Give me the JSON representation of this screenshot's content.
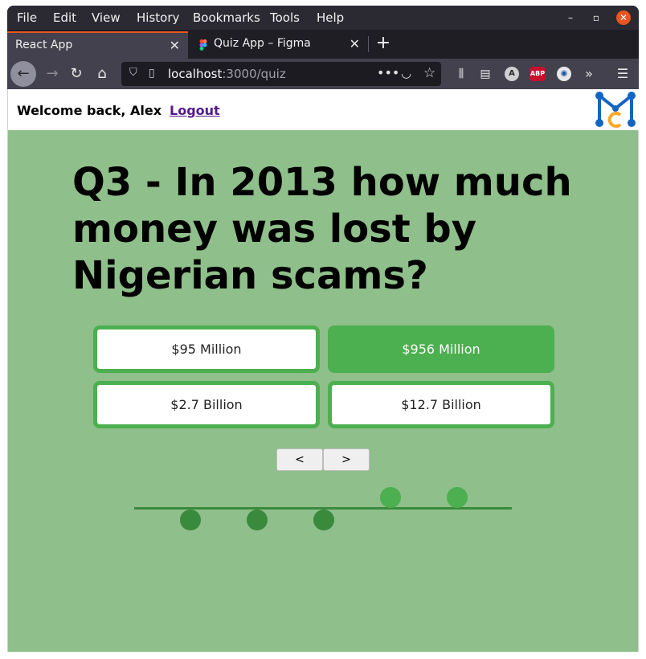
{
  "menubar": {
    "items": [
      "File",
      "Edit",
      "View",
      "History",
      "Bookmarks",
      "Tools",
      "Help"
    ]
  },
  "tabs": [
    {
      "label": "React App",
      "active": true
    },
    {
      "label": "Quiz App – Figma",
      "active": false
    }
  ],
  "urlbar": {
    "host": "localhost",
    "path": ":3000/quiz"
  },
  "toolbar_icons": [
    "library-icon",
    "reader-view-icon",
    "account-icon",
    "adblock-icon",
    "extension-icon",
    "overflow-icon",
    "menu-icon"
  ],
  "header": {
    "welcome": "Welcome back, Alex",
    "logout": "Logout"
  },
  "quiz": {
    "question": "Q3 - In 2013 how much money was lost by Nigerian scams?",
    "answers": [
      {
        "label": "$95 Million",
        "selected": false
      },
      {
        "label": "$956 Million",
        "selected": true
      },
      {
        "label": "$2.7 Billion",
        "selected": false
      },
      {
        "label": "$12.7 Billion",
        "selected": false
      }
    ],
    "prev_label": "<",
    "next_label": ">",
    "progress": {
      "answered": 3,
      "total": 5
    }
  },
  "colors": {
    "page_bg": "#8fbf8a",
    "accent": "#4caf50",
    "accent_dark": "#3a8a3e"
  }
}
